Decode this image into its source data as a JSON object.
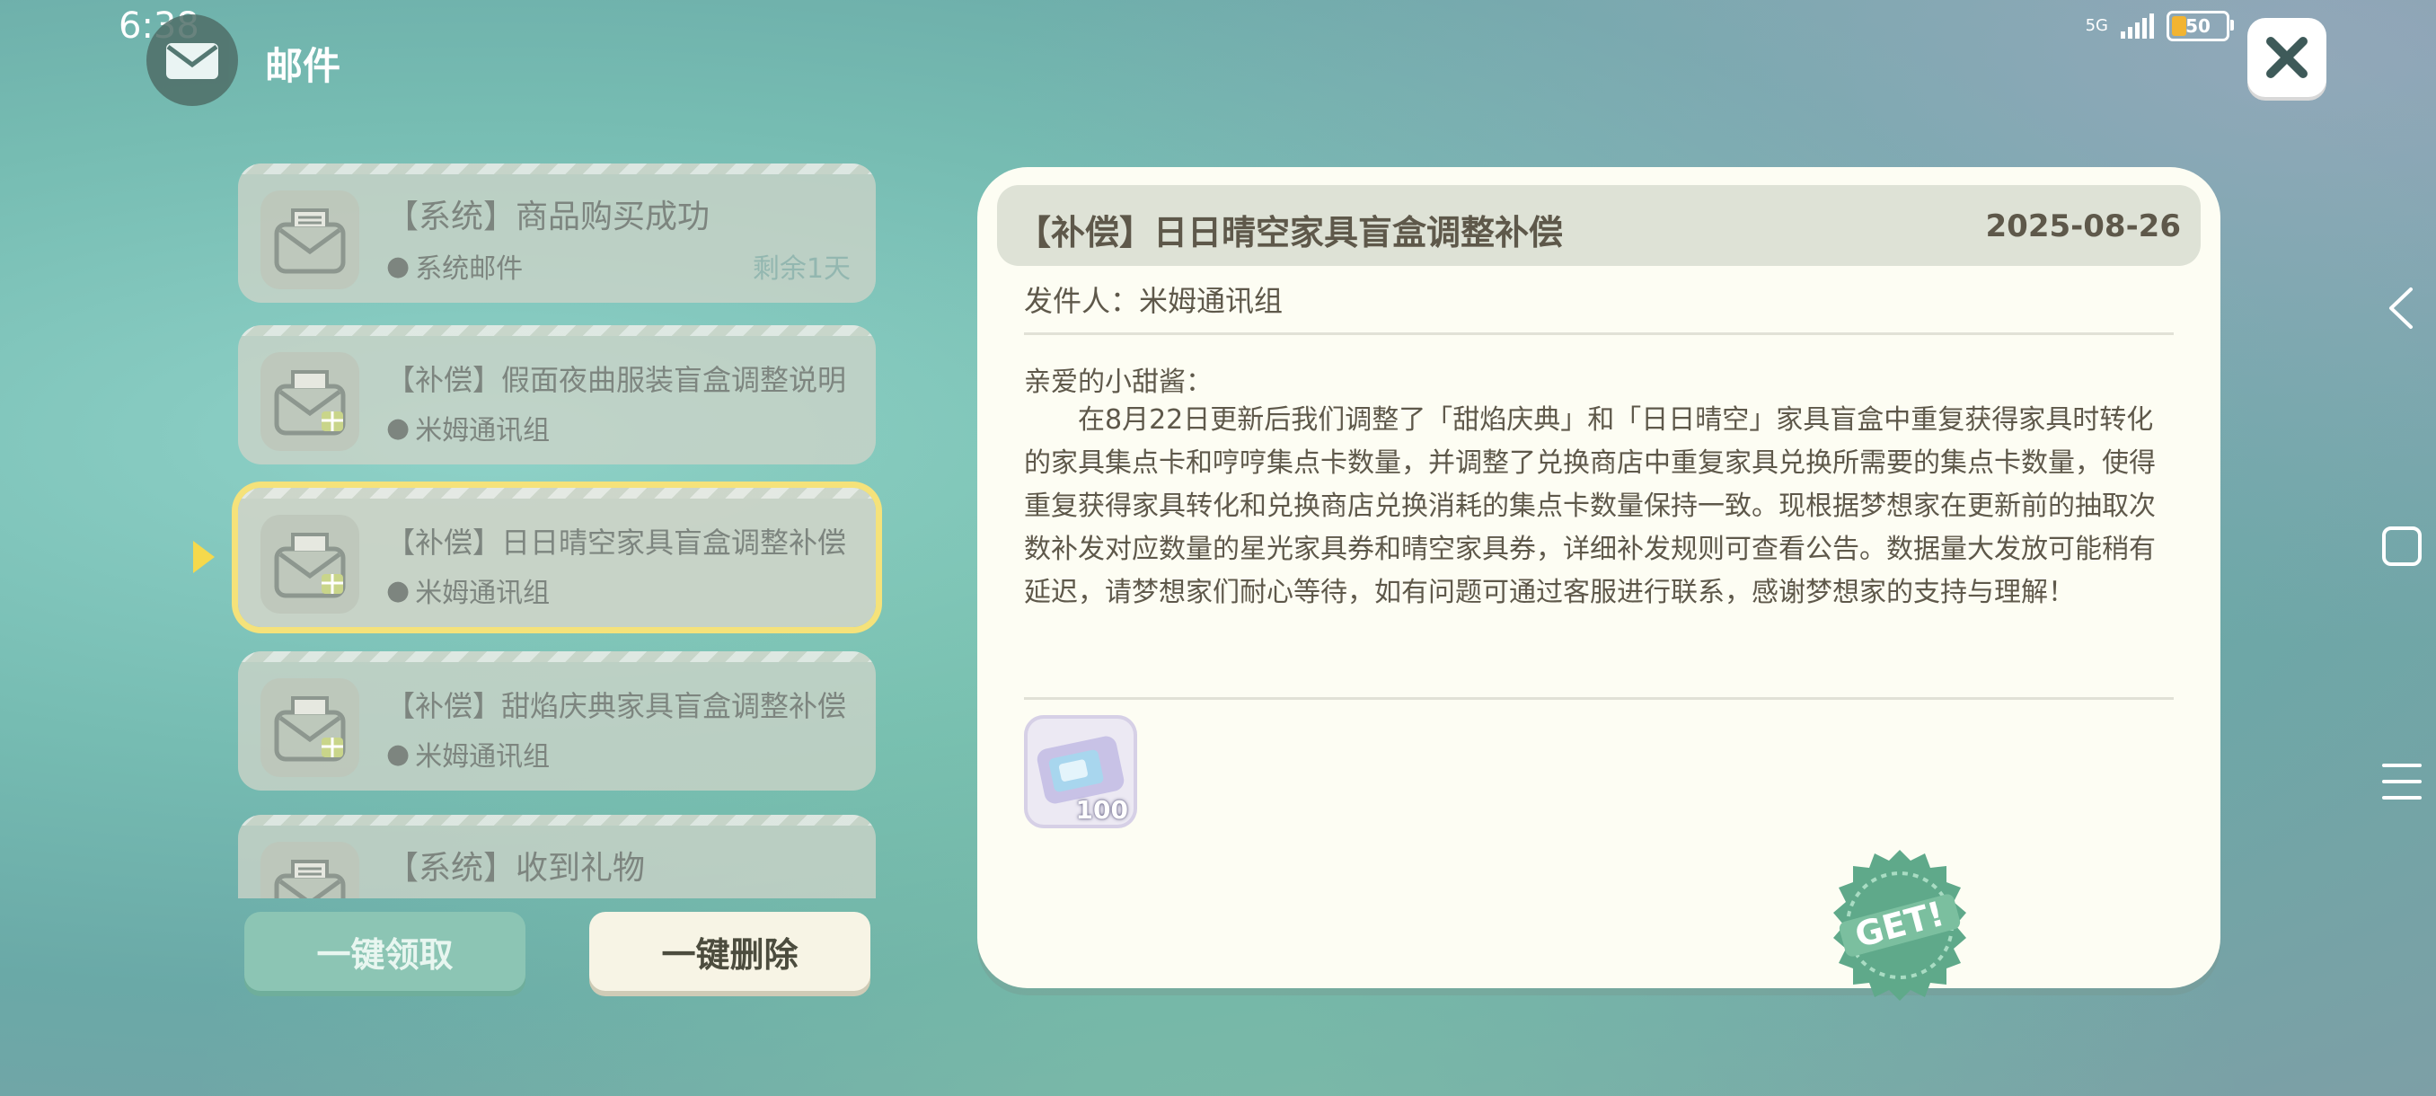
{
  "status_bar": {
    "time": "6:38",
    "network": "5G",
    "battery": "50"
  },
  "header": {
    "title": "邮件"
  },
  "mail_list": [
    {
      "title": "【系统】商品购买成功",
      "sender": "系统邮件",
      "expire": "剩余1天",
      "icon": "envelope-icon"
    },
    {
      "title": "【补偿】假面夜曲服装盲盒调整说明",
      "sender": "米姆通讯组",
      "expire": "",
      "icon": "envelope-gift-icon"
    },
    {
      "title": "【补偿】日日晴空家具盲盒调整补偿",
      "sender": "米姆通讯组",
      "expire": "",
      "icon": "envelope-gift-icon",
      "selected": true
    },
    {
      "title": "【补偿】甜焰庆典家具盲盒调整补偿",
      "sender": "米姆通讯组",
      "expire": "",
      "icon": "envelope-gift-icon"
    },
    {
      "title": "【系统】收到礼物",
      "sender": "",
      "expire": "",
      "icon": "envelope-icon"
    }
  ],
  "actions": {
    "claim_all": "一键领取",
    "delete_all": "一键删除"
  },
  "detail": {
    "title": "【补偿】日日晴空家具盲盒调整补偿",
    "date": "2025-08-26",
    "sender_line": "发件人：米姆通讯组",
    "greeting": "亲爱的小甜酱：",
    "body": "在8月22日更新后我们调整了「甜焰庆典」和「日日晴空」家具盲盒中重复获得家具时转化的家具集点卡和哼哼集点卡数量，并调整了兑换商店中重复家具兑换所需要的集点卡数量，使得重复获得家具转化和兑换商店兑换消耗的集点卡数量保持一致。现根据梦想家在更新前的抽取次数补发对应数量的星光家具券和晴空家具券，详细补发规则可查看公告。数据量大发放可能稍有延迟，请梦想家们耐心等待，如有问题可通过客服进行联系，感谢梦想家的支持与理解！",
    "attachment": {
      "icon": "furniture-ticket-icon",
      "quantity": "100"
    },
    "stamp": "GET!"
  },
  "colors": {
    "accent_selected": "#f5e27a",
    "claim_button": "#8cc5b4",
    "card_bg": "#fdfdf3"
  }
}
